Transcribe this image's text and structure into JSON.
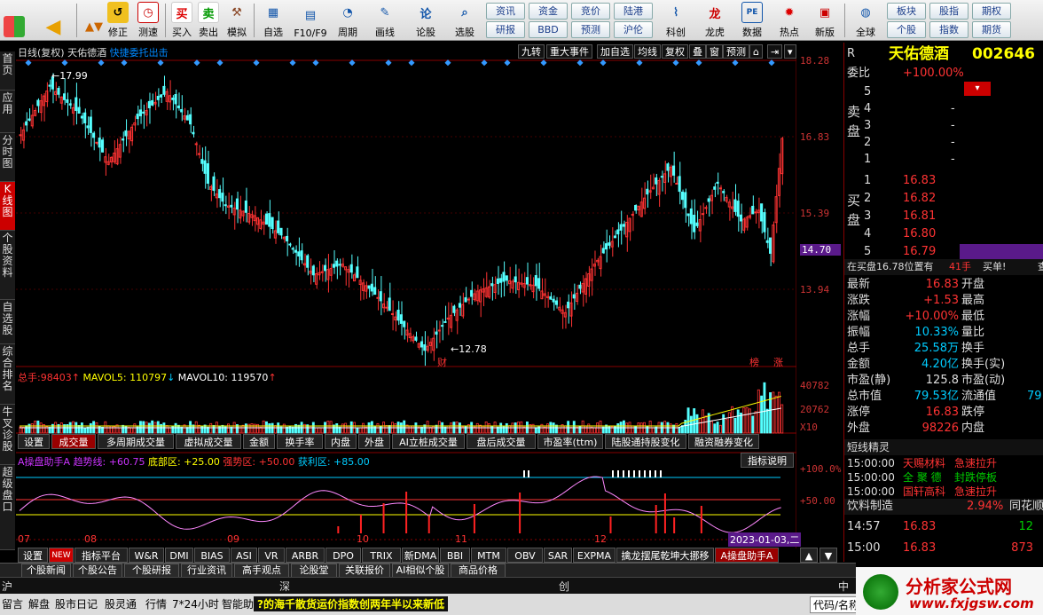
{
  "toolbar": {
    "items": [
      "买入",
      "卖出",
      "模拟",
      "修正",
      "测速",
      "自选",
      "F10/F9",
      "周期",
      "画线",
      "论股",
      "选股",
      "科创",
      "龙虎",
      "数据",
      "热点",
      "新版",
      "全球"
    ],
    "grid1": [
      "资讯",
      "资金",
      "竞价",
      "陆港",
      "研报",
      "BBD",
      "预测",
      "沪伦"
    ],
    "grid2": [
      "板块",
      "股指",
      "期权",
      "个股",
      "指数",
      "期货"
    ]
  },
  "lefttabs": [
    "首页",
    "应用",
    "分时图",
    "K线图",
    "个股资料",
    "自选股",
    "综合排名",
    "牛叉诊股",
    "超级盘口"
  ],
  "chart": {
    "header": {
      "period": "日线(复权)",
      "name": "天佑德酒",
      "hint": "快捷委托出击"
    },
    "right_buttons": [
      "九转",
      "重大事件",
      "加自选",
      "均线",
      "复权",
      "叠",
      "窗",
      "预测"
    ],
    "price_labels": [
      "18.28",
      "16.83",
      "15.39",
      "14.70",
      "13.94"
    ],
    "hi_mark": "17.99",
    "lo_mark": "12.78",
    "badge_cai": "财",
    "badge_bang": "榜",
    "badge_zhang": "涨"
  },
  "volume": {
    "label_total": "总手:",
    "value_total": "98403",
    "label_ma5": "MAVOL5:",
    "value_ma5": "110797",
    "label_ma10": "MAVOL10:",
    "value_ma10": "119570",
    "y_labels": [
      "40782",
      "20762",
      "X10"
    ]
  },
  "volume_tabs": [
    "设置",
    "成交量",
    "多周期成交量",
    "虚拟成交量",
    "金额",
    "换手率",
    "内盘",
    "外盘",
    "AI立桩成交量",
    "盘后成交量",
    "市盈率(ttm)",
    "陆股通持股变化",
    "融资融券变化"
  ],
  "indicator": {
    "name": "A操盘助手A",
    "trend": "趋势线: +60.75",
    "bottom": "底部区: +25.00",
    "strong": "强势区: +50.00",
    "profit": "获利区: +85.00",
    "btn": "指标说明",
    "y_labels": [
      "+100.0%",
      "+50.00"
    ]
  },
  "x_labels": [
    "07",
    "08",
    "09",
    "10",
    "11",
    "12"
  ],
  "date_box": "2023-01-03,二",
  "indicator_tabs": [
    "设置",
    "NEW",
    "指标平台",
    "W&R",
    "DMI",
    "BIAS",
    "ASI",
    "VR",
    "ARBR",
    "DPO",
    "TRIX",
    "新DMA",
    "BBI",
    "MTM",
    "OBV",
    "SAR",
    "EXPMA",
    "擒龙摆尾乾坤大挪移",
    "A操盘助手A"
  ],
  "news_tabs": [
    "个股新闻",
    "个股公告",
    "个股研报",
    "行业资讯",
    "高手观点",
    "论股堂",
    "关联报价",
    "AI相似个股",
    "商品价格"
  ],
  "market": [
    "沪",
    "深",
    "创",
    "中"
  ],
  "status": {
    "items": [
      "留言",
      "解盘",
      "股市日记",
      "股灵通",
      "行情",
      "7*24小时",
      "智能助手"
    ],
    "ticker": "?的海千散货运价指数创两年半以来新低",
    "code_label": "代码/名称",
    "logo_cn": "分析家公式网",
    "logo_url": "www.fxjgsw.com"
  },
  "quote": {
    "r": "R",
    "name": "天佑德酒",
    "code": "002646",
    "webi_label": "委比",
    "webi_val": "+100.00%",
    "sell": [
      [
        "5",
        "",
        ""
      ],
      [
        "4",
        "",
        "-"
      ],
      [
        "3",
        "",
        "-"
      ],
      [
        "2",
        "",
        "-"
      ],
      [
        "1",
        "",
        "-"
      ]
    ],
    "buy": [
      [
        "1",
        "16.83",
        ""
      ],
      [
        "2",
        "16.82",
        ""
      ],
      [
        "3",
        "16.81",
        ""
      ],
      [
        "4",
        "16.80",
        ""
      ],
      [
        "5",
        "16.79",
        ""
      ]
    ],
    "zaibuy": "在买盘16.78位置有",
    "zaibuy_n": "41手",
    "zaibuy_t": "买单!",
    "zaibuy_x": "查",
    "stats": [
      [
        "最新",
        "16.83",
        "开盘",
        ""
      ],
      [
        "涨跌",
        "+1.53",
        "最高",
        ""
      ],
      [
        "涨幅",
        "+10.00%",
        "最低",
        ""
      ],
      [
        "振幅",
        "10.33%",
        "量比",
        ""
      ],
      [
        "总手",
        "25.58万",
        "换手",
        ""
      ],
      [
        "金额",
        "4.20亿",
        "换手(实)",
        ""
      ],
      [
        "市盈(静)",
        "125.8",
        "市盈(动)",
        ""
      ],
      [
        "总市值",
        "79.53亿",
        "流通值",
        "79"
      ],
      [
        "涨停",
        "16.83",
        "跌停",
        ""
      ],
      [
        "外盘",
        "98226",
        "内盘",
        ""
      ]
    ],
    "jl_title": "短线精灵",
    "jl": [
      [
        "15:00:00",
        "天赐材料",
        "急速拉升"
      ],
      [
        "15:00:00",
        "全 聚 德",
        "封跌停板"
      ],
      [
        "15:00:00",
        "国轩高科",
        "急速拉升"
      ]
    ],
    "sector": "饮料制造",
    "sector_pct": "2.94%",
    "sector_tag": "同花顺",
    "ticks": [
      [
        "14:57",
        "16.83",
        "12"
      ],
      [
        "15:00",
        "16.83",
        "873"
      ]
    ]
  }
}
